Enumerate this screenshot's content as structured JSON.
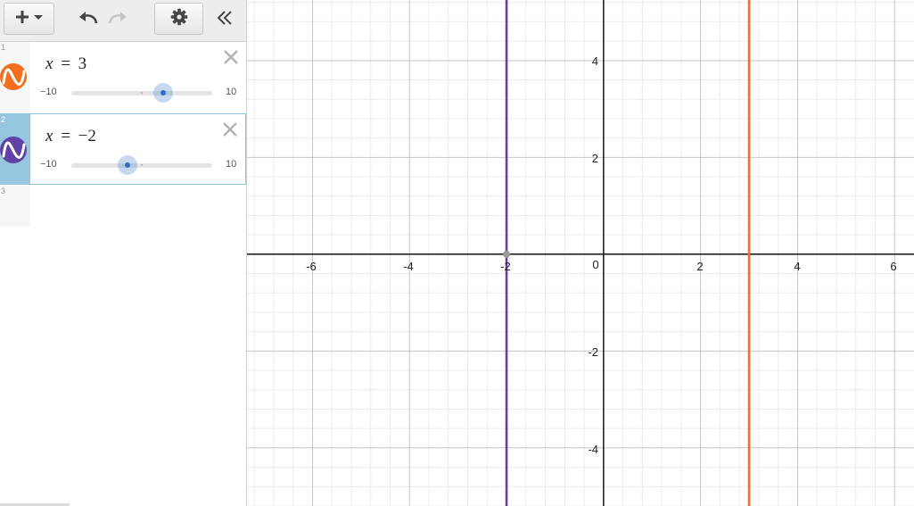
{
  "toolbar": {
    "buttons": [
      {
        "name": "add-expression",
        "icon": "plus-dropdown-icon"
      },
      {
        "name": "undo",
        "icon": "undo-icon"
      },
      {
        "name": "redo",
        "icon": "redo-icon"
      },
      {
        "name": "settings",
        "icon": "gear-icon"
      },
      {
        "name": "collapse-sidebar",
        "icon": "double-chevron-left-icon"
      }
    ]
  },
  "expressions": [
    {
      "index": "1",
      "variable": "x",
      "operator": "=",
      "value_text": "3",
      "value": 3,
      "color": "#f26f1e",
      "slider": {
        "min_label": "−10",
        "max_label": "10",
        "min": -10,
        "max": 10,
        "value": 3
      }
    },
    {
      "index": "2",
      "variable": "x",
      "operator": "=",
      "value_text": "−2",
      "value": -2,
      "color": "#6042a6",
      "active": true,
      "slider": {
        "min_label": "−10",
        "max_label": "10",
        "min": -10,
        "max": 10,
        "value": -2
      }
    },
    {
      "index": "3"
    }
  ],
  "graph": {
    "x_range": [
      -7.35,
      6.4
    ],
    "y_range": [
      -5.2,
      5.25
    ],
    "x_ticks": [
      "-6",
      "-4",
      "-2",
      "0",
      "2",
      "4",
      "6"
    ],
    "y_ticks": [
      "4",
      "2",
      "-2",
      "-4"
    ],
    "point": {
      "x": -2,
      "y": 0
    }
  },
  "colors": {
    "orange": "#f26f1e",
    "purple": "#6042a6",
    "active_gutter": "#97c6e0"
  }
}
